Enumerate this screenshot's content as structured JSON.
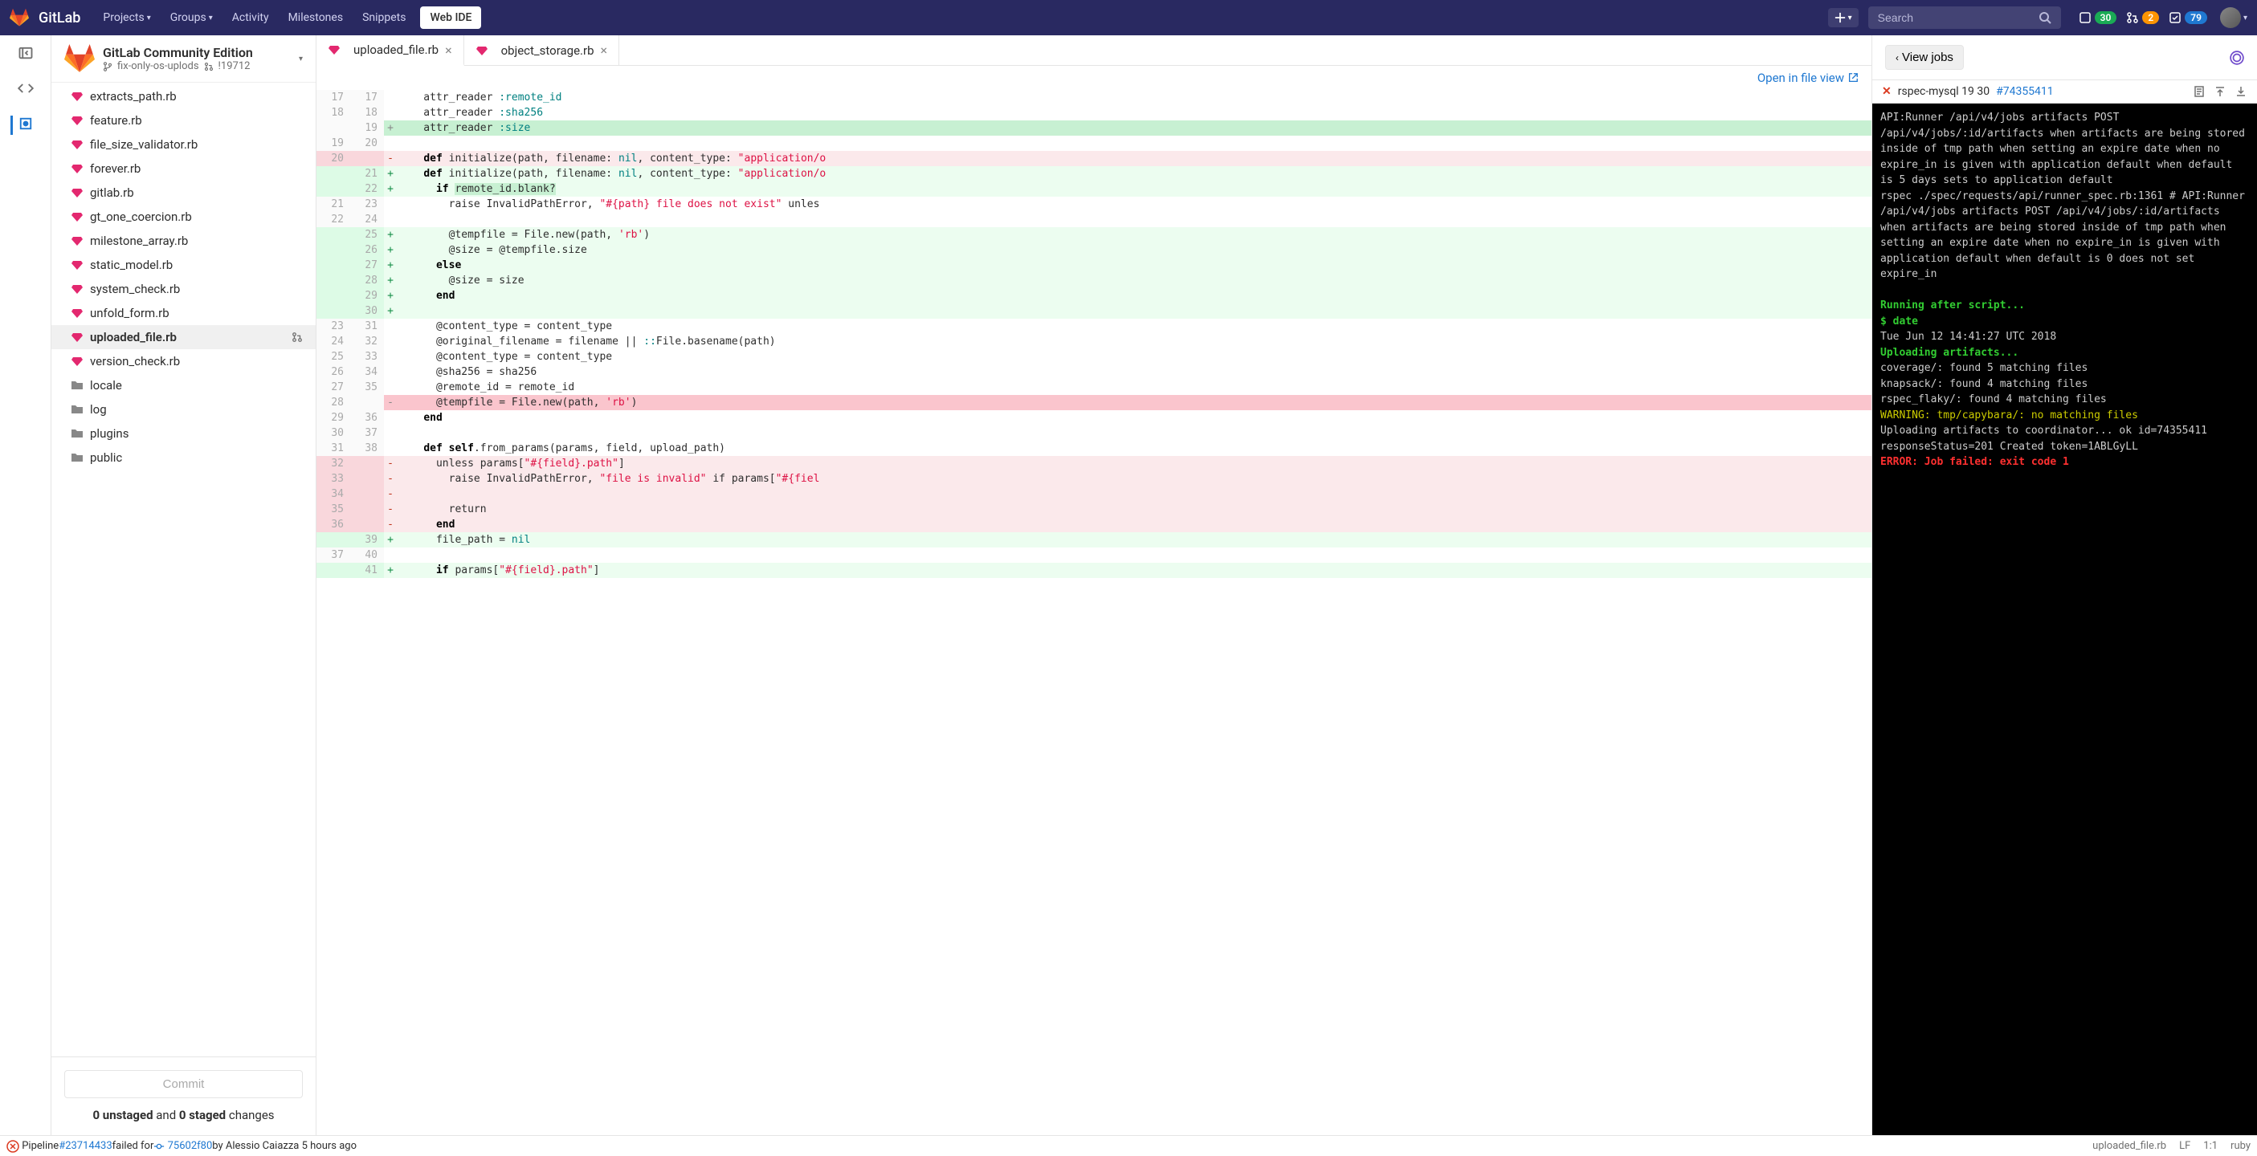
{
  "topbar": {
    "brand": "GitLab",
    "nav": [
      "Projects",
      "Groups",
      "Activity",
      "Milestones",
      "Snippets"
    ],
    "webide": "Web IDE",
    "search_placeholder": "Search",
    "badges": {
      "issues": "30",
      "merge": "2",
      "todos": "79"
    }
  },
  "project": {
    "title": "GitLab Community Edition",
    "branch": "fix-only-os-uplods",
    "mr": "!19712"
  },
  "tree": [
    {
      "name": "extracts_path.rb",
      "type": "ruby"
    },
    {
      "name": "feature.rb",
      "type": "ruby"
    },
    {
      "name": "file_size_validator.rb",
      "type": "ruby"
    },
    {
      "name": "forever.rb",
      "type": "ruby"
    },
    {
      "name": "gitlab.rb",
      "type": "ruby"
    },
    {
      "name": "gt_one_coercion.rb",
      "type": "ruby"
    },
    {
      "name": "milestone_array.rb",
      "type": "ruby"
    },
    {
      "name": "static_model.rb",
      "type": "ruby"
    },
    {
      "name": "system_check.rb",
      "type": "ruby"
    },
    {
      "name": "unfold_form.rb",
      "type": "ruby"
    },
    {
      "name": "uploaded_file.rb",
      "type": "ruby",
      "active": true,
      "mr": true
    },
    {
      "name": "version_check.rb",
      "type": "ruby"
    },
    {
      "name": "locale",
      "type": "folder"
    },
    {
      "name": "log",
      "type": "folder"
    },
    {
      "name": "plugins",
      "type": "folder"
    },
    {
      "name": "public",
      "type": "folder"
    }
  ],
  "commit": {
    "button": "Commit",
    "unstaged": "0 unstaged",
    "and": " and ",
    "staged": "0 staged",
    "changes": " changes"
  },
  "tabs": [
    {
      "name": "uploaded_file.rb",
      "active": true
    },
    {
      "name": "object_storage.rb",
      "active": false
    }
  ],
  "editor_link": "Open in file view",
  "diff": [
    {
      "o": "17",
      "n": "17",
      "s": "",
      "t": "context",
      "h": "    attr_reader <span class='sym'>:remote_id</span>"
    },
    {
      "o": "18",
      "n": "18",
      "s": "",
      "t": "context",
      "h": "    attr_reader <span class='sym'>:sha256</span>"
    },
    {
      "o": "",
      "n": "19",
      "s": "+",
      "t": "added-dark",
      "h": "    attr_reader <span class='sym'>:size</span>"
    },
    {
      "o": "19",
      "n": "20",
      "s": "",
      "t": "context",
      "h": ""
    },
    {
      "o": "20",
      "n": "",
      "s": "-",
      "t": "removed",
      "h": "    <span class='def'>def</span> initialize(path, filename: <span class='nil'>nil</span>, content_type: <span class='str'>\"application/o</span>"
    },
    {
      "o": "",
      "n": "21",
      "s": "+",
      "t": "added",
      "h": "    <span class='def'>def</span> initialize(path, filename: <span class='nil'>nil</span>, content_type: <span class='str'>\"application/o</span>"
    },
    {
      "o": "",
      "n": "22",
      "s": "+",
      "t": "added",
      "h": "      <span class='def'>if</span> <span style='background:#c7f0d2'>remote_id.blank?</span>"
    },
    {
      "o": "21",
      "n": "23",
      "s": "",
      "t": "context",
      "h": "        raise InvalidPathError, <span class='str'>\"#{path} file does not exist\"</span> unles"
    },
    {
      "o": "22",
      "n": "24",
      "s": "",
      "t": "context",
      "h": ""
    },
    {
      "o": "",
      "n": "25",
      "s": "+",
      "t": "added",
      "h": "        @tempfile = File.new(path, <span class='str'>'rb'</span>)"
    },
    {
      "o": "",
      "n": "26",
      "s": "+",
      "t": "added",
      "h": "        @size = @tempfile.size"
    },
    {
      "o": "",
      "n": "27",
      "s": "+",
      "t": "added",
      "h": "      <span class='def'>else</span>"
    },
    {
      "o": "",
      "n": "28",
      "s": "+",
      "t": "added",
      "h": "        @size = size"
    },
    {
      "o": "",
      "n": "29",
      "s": "+",
      "t": "added",
      "h": "      <span class='def'>end</span>"
    },
    {
      "o": "",
      "n": "30",
      "s": "+",
      "t": "added",
      "h": ""
    },
    {
      "o": "23",
      "n": "31",
      "s": "",
      "t": "context",
      "h": "      @content_type = content_type"
    },
    {
      "o": "24",
      "n": "32",
      "s": "",
      "t": "context",
      "h": "      @original_filename = filename || <span class='sym'>::</span>File.basename(path)"
    },
    {
      "o": "25",
      "n": "33",
      "s": "",
      "t": "context",
      "h": "      @content_type = content_type"
    },
    {
      "o": "26",
      "n": "34",
      "s": "",
      "t": "context",
      "h": "      @sha256 = sha256"
    },
    {
      "o": "27",
      "n": "35",
      "s": "",
      "t": "context",
      "h": "      @remote_id = remote_id"
    },
    {
      "o": "28",
      "n": "",
      "s": "-",
      "t": "removed-dark",
      "h": "      @tempfile = File.new(path, <span class='str'>'rb'</span>)"
    },
    {
      "o": "29",
      "n": "36",
      "s": "",
      "t": "context",
      "h": "    <span class='def'>end</span>"
    },
    {
      "o": "30",
      "n": "37",
      "s": "",
      "t": "context",
      "h": ""
    },
    {
      "o": "31",
      "n": "38",
      "s": "",
      "t": "context",
      "h": "    <span class='def'>def</span> <span class='def'>self</span>.from_params(params, field, upload_path)"
    },
    {
      "o": "32",
      "n": "",
      "s": "-",
      "t": "removed",
      "h": "      unless params[<span class='str'>\"#{field}.path\"</span>]"
    },
    {
      "o": "33",
      "n": "",
      "s": "-",
      "t": "removed",
      "h": "        raise InvalidPathError, <span class='str'>\"file is invalid\"</span> if params[<span class='str'>\"#{fiel</span>"
    },
    {
      "o": "34",
      "n": "",
      "s": "-",
      "t": "removed",
      "h": ""
    },
    {
      "o": "35",
      "n": "",
      "s": "-",
      "t": "removed",
      "h": "        return"
    },
    {
      "o": "36",
      "n": "",
      "s": "-",
      "t": "removed",
      "h": "      <span class='def'>end</span>"
    },
    {
      "o": "",
      "n": "39",
      "s": "+",
      "t": "added",
      "h": "      file_path = <span class='nil'>nil</span>"
    },
    {
      "o": "37",
      "n": "40",
      "s": "",
      "t": "context",
      "h": ""
    },
    {
      "o": "",
      "n": "41",
      "s": "+",
      "t": "added",
      "h": "      <span class='def'>if</span> params[<span class='str'>\"#{field}.path\"</span>]"
    }
  ],
  "right": {
    "view_jobs": "View jobs",
    "job_name": "rspec-mysql 19 30",
    "job_id": "#74355411",
    "terminal": [
      {
        "c": "",
        "t": "API:Runner /api/v4/jobs artifacts POST /api/v4/jobs/:id/artifacts when artifacts are being stored inside of tmp path when setting an expire date when no expire_in is given with application default when default is 5 days sets to application default"
      },
      {
        "c": "",
        "t": "rspec ./spec/requests/api/runner_spec.rb:1361 # API:Runner /api/v4/jobs artifacts POST /api/v4/jobs/:id/artifacts when artifacts are being stored inside of tmp path when setting an expire date when no expire_in is given with application default when default is 0 does not set expire_in"
      },
      {
        "c": "",
        "t": ""
      },
      {
        "c": "term-green",
        "t": "Running after script..."
      },
      {
        "c": "term-green",
        "t": "$ date"
      },
      {
        "c": "",
        "t": "Tue Jun 12 14:41:27 UTC 2018"
      },
      {
        "c": "term-green",
        "t": "Uploading artifacts..."
      },
      {
        "c": "",
        "t": "coverage/: found 5 matching files"
      },
      {
        "c": "",
        "t": "knapsack/: found 4 matching files"
      },
      {
        "c": "",
        "t": "rspec_flaky/: found 4 matching files"
      },
      {
        "c": "term-yellow",
        "t": "WARNING: tmp/capybara/: no matching files"
      },
      {
        "c": "",
        "t": "Uploading artifacts to coordinator... ok    id=74355411 responseStatus=201 Created token=1ABLGyLL"
      },
      {
        "c": "term-red",
        "t": "ERROR: Job failed: exit code 1"
      }
    ]
  },
  "status": {
    "pipeline_text": "Pipeline ",
    "pipeline_id": "#23714433",
    "failed_for": " failed for ",
    "commit_sha": "75602f80",
    "by": " by Alessio Caiazza 5 hours ago",
    "file": "uploaded_file.rb",
    "lf": "LF",
    "pos": "1:1",
    "lang": "ruby"
  }
}
